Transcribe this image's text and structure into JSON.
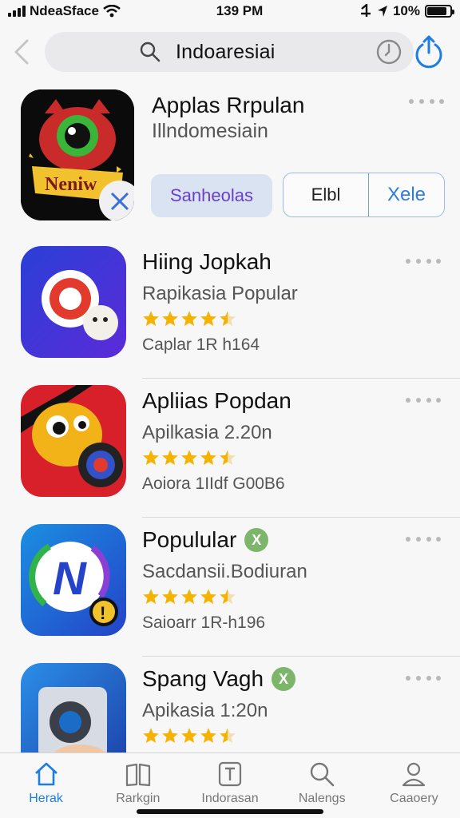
{
  "status_bar": {
    "carrier": "NdeaSface",
    "time": "139 PM",
    "battery": "10%",
    "battery_level": 0.85
  },
  "search": {
    "query": "Indoaresiai",
    "icons": [
      "back-chevron-icon",
      "search-icon",
      "clock-icon",
      "share-icon"
    ]
  },
  "featured": {
    "title": "Applas Rrpulan",
    "subtitle": "Illndomesiain",
    "chip_label": "Sanheolas",
    "segment_left": "Elbl",
    "segment_right": "Xele"
  },
  "apps": [
    {
      "title": "Hiing Jopkah",
      "subtitle": "Rapikasia Popular",
      "meta": "Caplar 1R h164",
      "rating": 4.5,
      "badge": null
    },
    {
      "title": "Apliias Popdan",
      "subtitle": "Apilkasia 2.20n",
      "meta": "Aoiora 1IIdf G00B6",
      "rating": 4.5,
      "badge": null
    },
    {
      "title": "Populular",
      "subtitle": "Sacdansii.Bodiuran",
      "meta": "Saioarr 1R-h196",
      "rating": 4.5,
      "badge": "X"
    },
    {
      "title": "Spang Vagh",
      "subtitle": "Apikasia 1:20n",
      "meta": "",
      "rating": 4.5,
      "badge": "X"
    }
  ],
  "tabs": [
    {
      "label": "Herak",
      "icon": "home-icon",
      "active": true
    },
    {
      "label": "Rarkgin",
      "icon": "book-icon",
      "active": false
    },
    {
      "label": "Indorasan",
      "icon": "tile-icon",
      "active": false
    },
    {
      "label": "Nalengs",
      "icon": "search-icon",
      "active": false
    },
    {
      "label": "Caaoery",
      "icon": "person-icon",
      "active": false
    }
  ],
  "colors": {
    "accent": "#1e7ee0",
    "star": "#f5b301",
    "chip_bg": "#d9e3f2",
    "chip_text": "#6a3fc9",
    "badge": "#7db56a"
  }
}
